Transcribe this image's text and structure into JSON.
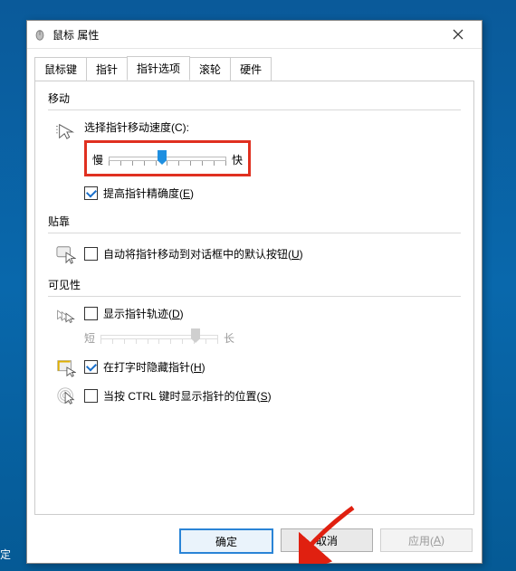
{
  "window": {
    "title": "鼠标 属性",
    "close_aria": "关闭"
  },
  "tabs": {
    "t0": "鼠标键",
    "t1": "指针",
    "t2": "指针选项",
    "t3": "滚轮",
    "t4": "硬件"
  },
  "groups": {
    "motion": {
      "title": "移动",
      "speed_label": "选择指针移动速度(C):",
      "slow": "慢",
      "fast": "快",
      "enhance_label": "提高指针精确度(E)",
      "enhance_checked": true,
      "speed_value": 5,
      "speed_max": 11
    },
    "snap": {
      "title": "贴靠",
      "snap_label": "自动将指针移动到对话框中的默认按钮(U)",
      "snap_checked": false
    },
    "visibility": {
      "title": "可见性",
      "trail_label": "显示指针轨迹(D)",
      "trail_checked": false,
      "trail_short": "短",
      "trail_long": "长",
      "hide_typing_label": "在打字时隐藏指针(H)",
      "hide_typing_checked": true,
      "ctrl_label": "当按 CTRL 键时显示指针的位置(S)",
      "ctrl_checked": false
    }
  },
  "buttons": {
    "ok": "确定",
    "cancel": "取消",
    "apply": "应用(A)"
  },
  "misc": {
    "taskbar_char": "定"
  }
}
